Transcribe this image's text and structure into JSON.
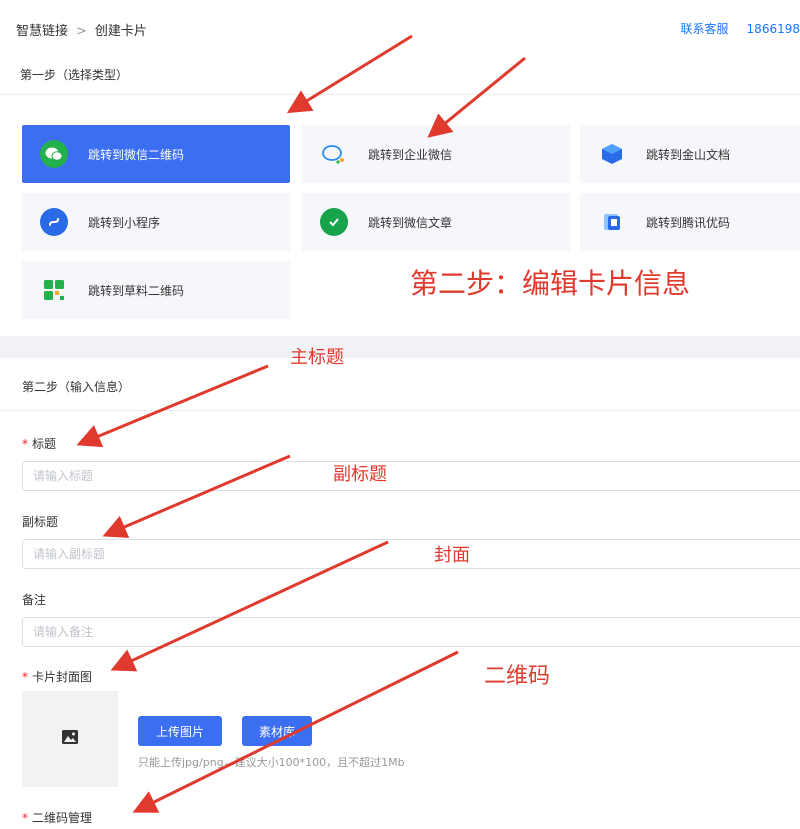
{
  "header": {
    "breadcrumb": [
      "智慧链接",
      "创建卡片"
    ],
    "contact": "联系客服",
    "phone": "1866198"
  },
  "step1": {
    "title": "第一步（选择类型）",
    "cards": [
      {
        "label": "跳转到微信二维码",
        "icon": "wechat-icon",
        "active": true
      },
      {
        "label": "跳转到企业微信",
        "icon": "wecom-icon"
      },
      {
        "label": "跳转到金山文档",
        "icon": "kdocs-icon"
      },
      {
        "label": "跳转到小程序",
        "icon": "miniprogram-icon"
      },
      {
        "label": "跳转到微信文章",
        "icon": "article-icon"
      },
      {
        "label": "跳转到腾讯优码",
        "icon": "tencent-youma-icon"
      },
      {
        "label": "跳转到草料二维码",
        "icon": "caoliao-qr-icon"
      }
    ]
  },
  "step2": {
    "title": "第二步（输入信息）",
    "fields": {
      "title": {
        "label": "标题",
        "required": "*",
        "placeholder": "请输入标题"
      },
      "subtitle": {
        "label": "副标题",
        "placeholder": "请输入副标题"
      },
      "remark": {
        "label": "备注",
        "placeholder": "请输入备注"
      }
    },
    "cover": {
      "label": "卡片封面图",
      "required": "*",
      "upload_button": "上传图片",
      "library_button": "素材库",
      "hint": "只能上传jpg/png，建议大小100*100，且不超过1Mb"
    },
    "qrcode": {
      "label": "二维码管理",
      "required": "*"
    }
  },
  "annotations": {
    "step2_heading": "第二步：编辑卡片信息",
    "main_title": "主标题",
    "subtitle": "副标题",
    "cover": "封面",
    "qrcode": "二维码"
  },
  "colors": {
    "primary": "#3c6ef2",
    "annotation": "#e03a2e",
    "required": "#f5222d"
  }
}
